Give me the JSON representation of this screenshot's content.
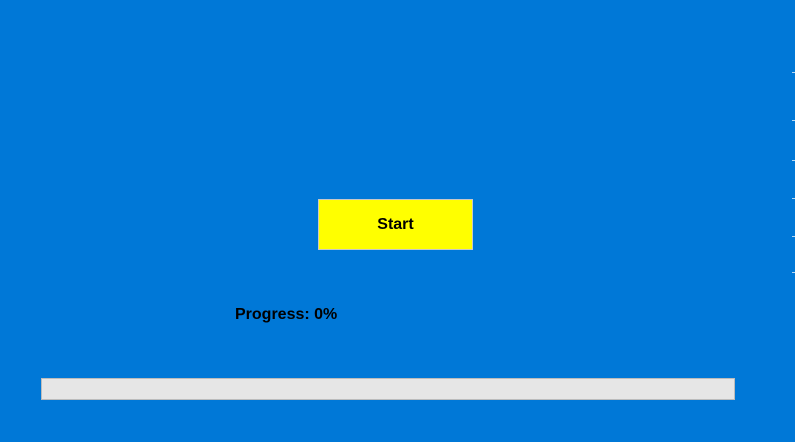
{
  "start_button": {
    "label": "Start",
    "background": "#ffff00"
  },
  "progress": {
    "label": "Progress: 0%",
    "value_percent": 0
  },
  "colors": {
    "window_background": "#0078d7",
    "progress_track": "#e6e6e6"
  }
}
